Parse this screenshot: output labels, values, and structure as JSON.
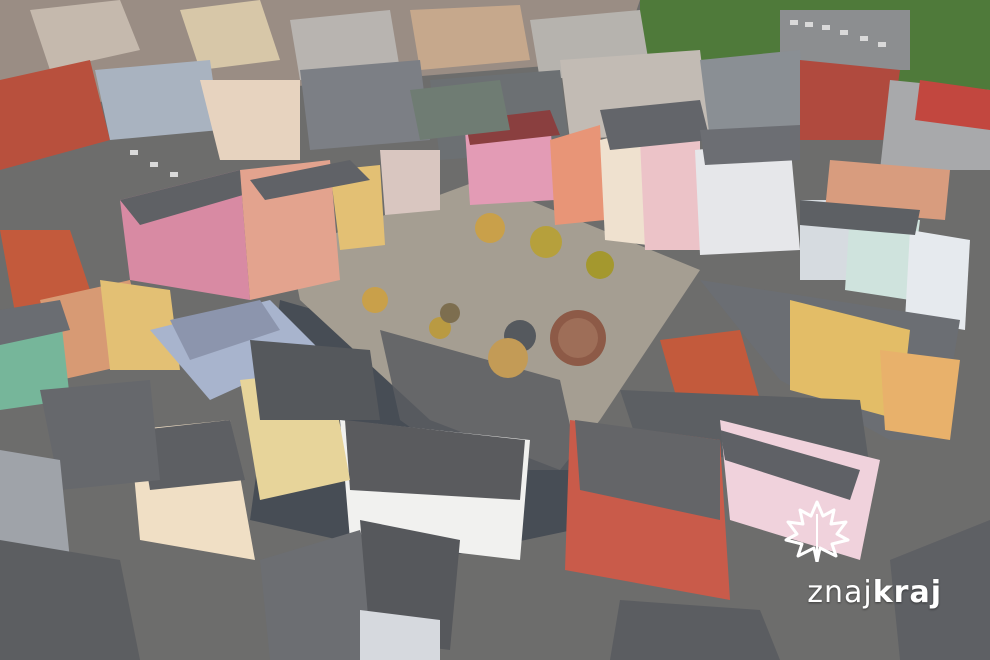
{
  "image": {
    "description_colors": {
      "square": "#a59e92",
      "shadow": "#474d55",
      "roof_grey": "#5f6165",
      "roof_red": "#b8503d",
      "facade_pink": "#d88aa3",
      "facade_yellow": "#e3c074",
      "tree_autumn": "#c9a04a",
      "trees_green": "#4f7a3a"
    }
  },
  "watermark": {
    "brand_light": "znaj",
    "brand_bold": "kraj",
    "logo_icon": "maple-leaf-icon"
  }
}
